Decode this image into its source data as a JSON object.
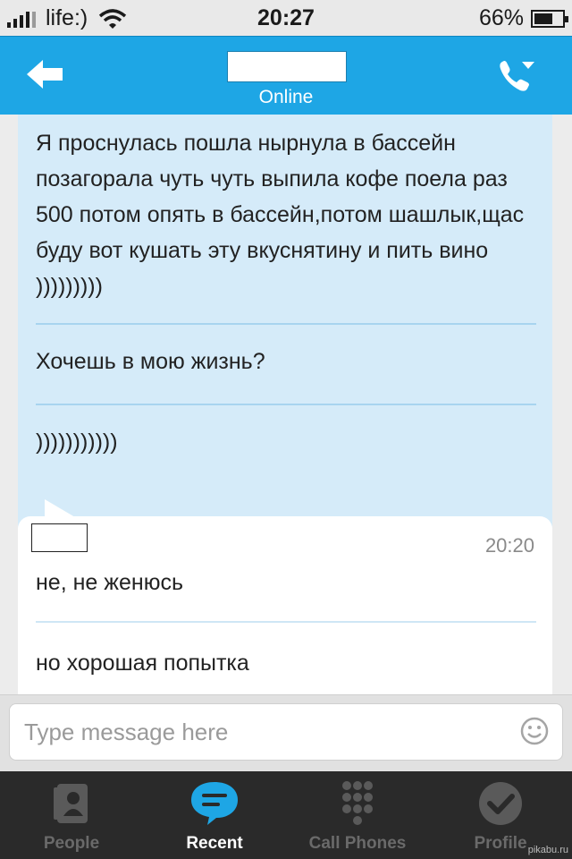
{
  "status_bar": {
    "carrier": "life:)",
    "time": "20:27",
    "battery_text": "66%",
    "battery_level": 0.66
  },
  "header": {
    "contact_status": "Online",
    "back_icon": "arrow-left-icon",
    "call_icon": "phone-icon"
  },
  "conversation": {
    "incoming": [
      "Я проснулась пошла нырнула в бассейн позагорала чуть чуть выпила кофе поела раз 500 потом опять в бассейн,потом шашлык,щас буду вот кушать эту вкуснятину и пить вино )))))))))",
      "Хочешь в мою жизнь?",
      ")))))))))))"
    ],
    "outgoing": {
      "time": "20:20",
      "messages": [
        "не, не женюсь",
        "но хорошая попытка"
      ]
    }
  },
  "input": {
    "placeholder": "Type message here",
    "emoji_icon": "smiley-icon"
  },
  "tabs": [
    {
      "label": "People",
      "icon": "contact-card-icon",
      "active": false
    },
    {
      "label": "Recent",
      "icon": "chat-bubble-icon",
      "active": true
    },
    {
      "label": "Call Phones",
      "icon": "dialpad-icon",
      "active": false
    },
    {
      "label": "Profile",
      "icon": "status-check-icon",
      "active": false
    }
  ],
  "watermark": "pikabu.ru",
  "colors": {
    "accent": "#1ea6e5",
    "incoming_bubble": "#d5ebf9",
    "tab_bar": "#2a2a2a"
  }
}
